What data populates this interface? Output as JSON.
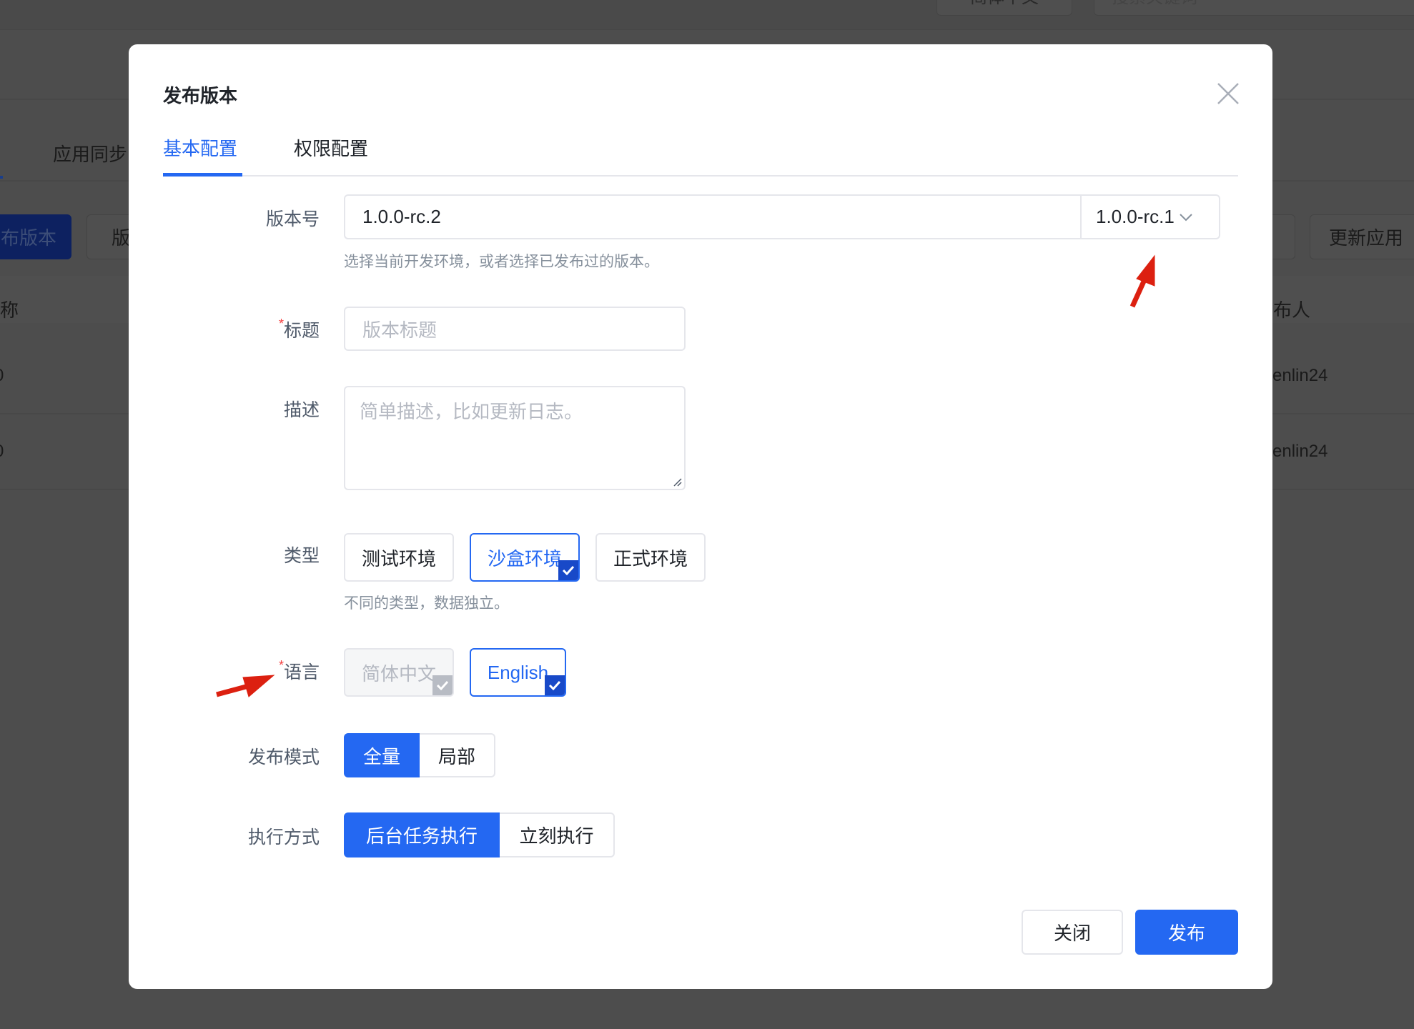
{
  "background": {
    "header_language": "简体中文",
    "header_search_placeholder": "搜索关键词",
    "tab_sync": "应用同步",
    "publish_button": "布版本",
    "version_button": "版",
    "update_app_button": "更新应用",
    "col_name": "称",
    "col_publisher": "布人",
    "rows": [
      {
        "name": "0",
        "publisher": "enlin24"
      },
      {
        "name": "0",
        "publisher": "enlin24"
      }
    ]
  },
  "modal": {
    "title": "发布版本",
    "tabs": [
      {
        "label": "基本配置",
        "active": true
      },
      {
        "label": "权限配置",
        "active": false
      }
    ],
    "version": {
      "label": "版本号",
      "value": "1.0.0-rc.2",
      "select_value": "1.0.0-rc.1",
      "help": "选择当前开发环境，或者选择已发布过的版本。"
    },
    "title_field": {
      "label": "标题",
      "required": true,
      "placeholder": "版本标题"
    },
    "description": {
      "label": "描述",
      "placeholder": "简单描述，比如更新日志。"
    },
    "type": {
      "label": "类型",
      "options": [
        "测试环境",
        "沙盒环境",
        "正式环境"
      ],
      "selected": "沙盒环境",
      "help": "不同的类型，数据独立。"
    },
    "language": {
      "label": "语言",
      "required": true,
      "options": [
        "简体中文",
        "English"
      ],
      "checked": [
        "简体中文",
        "English"
      ],
      "disabled": [
        "简体中文"
      ]
    },
    "publish_mode": {
      "label": "发布模式",
      "options": [
        "全量",
        "局部"
      ],
      "selected": "全量"
    },
    "execution": {
      "label": "执行方式",
      "options": [
        "后台任务执行",
        "立刻执行"
      ],
      "selected": "后台任务执行"
    },
    "footer": {
      "close_label": "关闭",
      "publish_label": "发布"
    },
    "required_mark": "*"
  },
  "colors": {
    "accent": "#2468f2",
    "annotation_arrow": "#dc2010",
    "overlay": "#4d4d4d"
  }
}
